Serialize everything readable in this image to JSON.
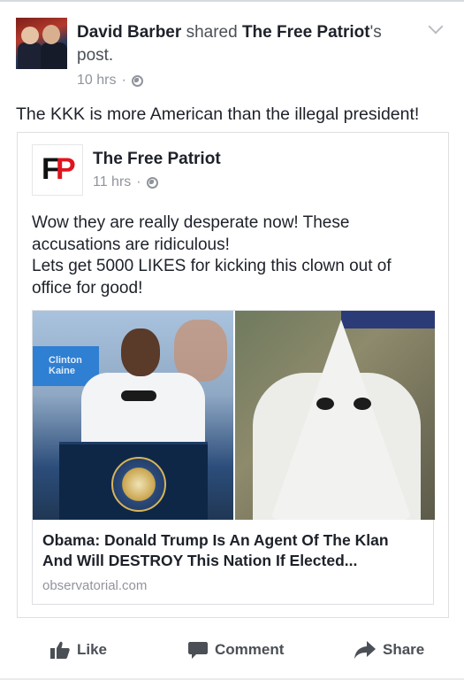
{
  "post": {
    "author": "David Barber",
    "action_text": "shared",
    "shared_page": "The Free Patriot",
    "possessive": "'s",
    "post_word": "post.",
    "time": "10 hrs",
    "separator": "·",
    "status_text": "The KKK is more American than the illegal president!"
  },
  "shared_post": {
    "page_name": "The Free Patriot",
    "time": "11 hrs",
    "separator": "·",
    "text_lines": [
      "Wow they are really desperate now! These",
      "accusations are ridiculous!",
      "Lets get 5000 LIKES for kicking this clown out of",
      "office for good!"
    ],
    "logo_letters": [
      "F",
      "P"
    ]
  },
  "link_preview": {
    "title_lines": [
      "Obama: Donald Trump Is An Agent Of The Klan",
      "And Will DESTROY This Nation If Elected..."
    ],
    "domain": "observatorial.com",
    "sign_text": "Clinton Kaine"
  },
  "actions": {
    "like": "Like",
    "comment": "Comment",
    "share": "Share"
  },
  "icons": {
    "avatar": "profile-photo",
    "globe": "globe-icon",
    "chevron": "chevron-down-icon",
    "like": "thumbs-up-icon",
    "comment": "speech-bubble-icon",
    "share": "share-arrow-icon"
  },
  "colors": {
    "text": "#1d2129",
    "muted": "#90949c",
    "action": "#4b4f56",
    "logo_red": "#e0141e"
  }
}
